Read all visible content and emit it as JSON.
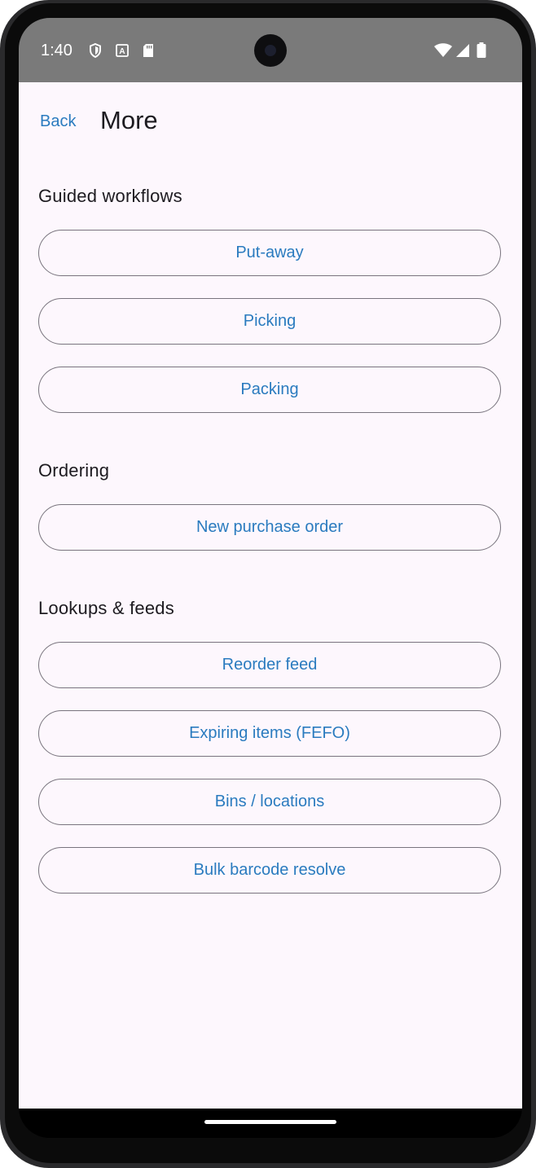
{
  "status_bar": {
    "time": "1:40",
    "left_icons": [
      "shield-icon",
      "a-box-icon",
      "sd-card-icon"
    ],
    "right_icons": [
      "wifi-icon",
      "signal-icon",
      "battery-icon"
    ]
  },
  "header": {
    "back_label": "Back",
    "title": "More"
  },
  "sections": [
    {
      "title": "Guided workflows",
      "buttons": [
        "Put-away",
        "Picking",
        "Packing"
      ]
    },
    {
      "title": "Ordering",
      "buttons": [
        "New purchase order"
      ]
    },
    {
      "title": "Lookups & feeds",
      "buttons": [
        "Reorder feed",
        "Expiring items (FEFO)",
        "Bins / locations",
        "Bulk barcode resolve"
      ]
    }
  ],
  "colors": {
    "accent": "#2a7bbf",
    "background": "#fdf7fd",
    "outline": "#79747e",
    "status_bar": "#7a7a7a"
  }
}
